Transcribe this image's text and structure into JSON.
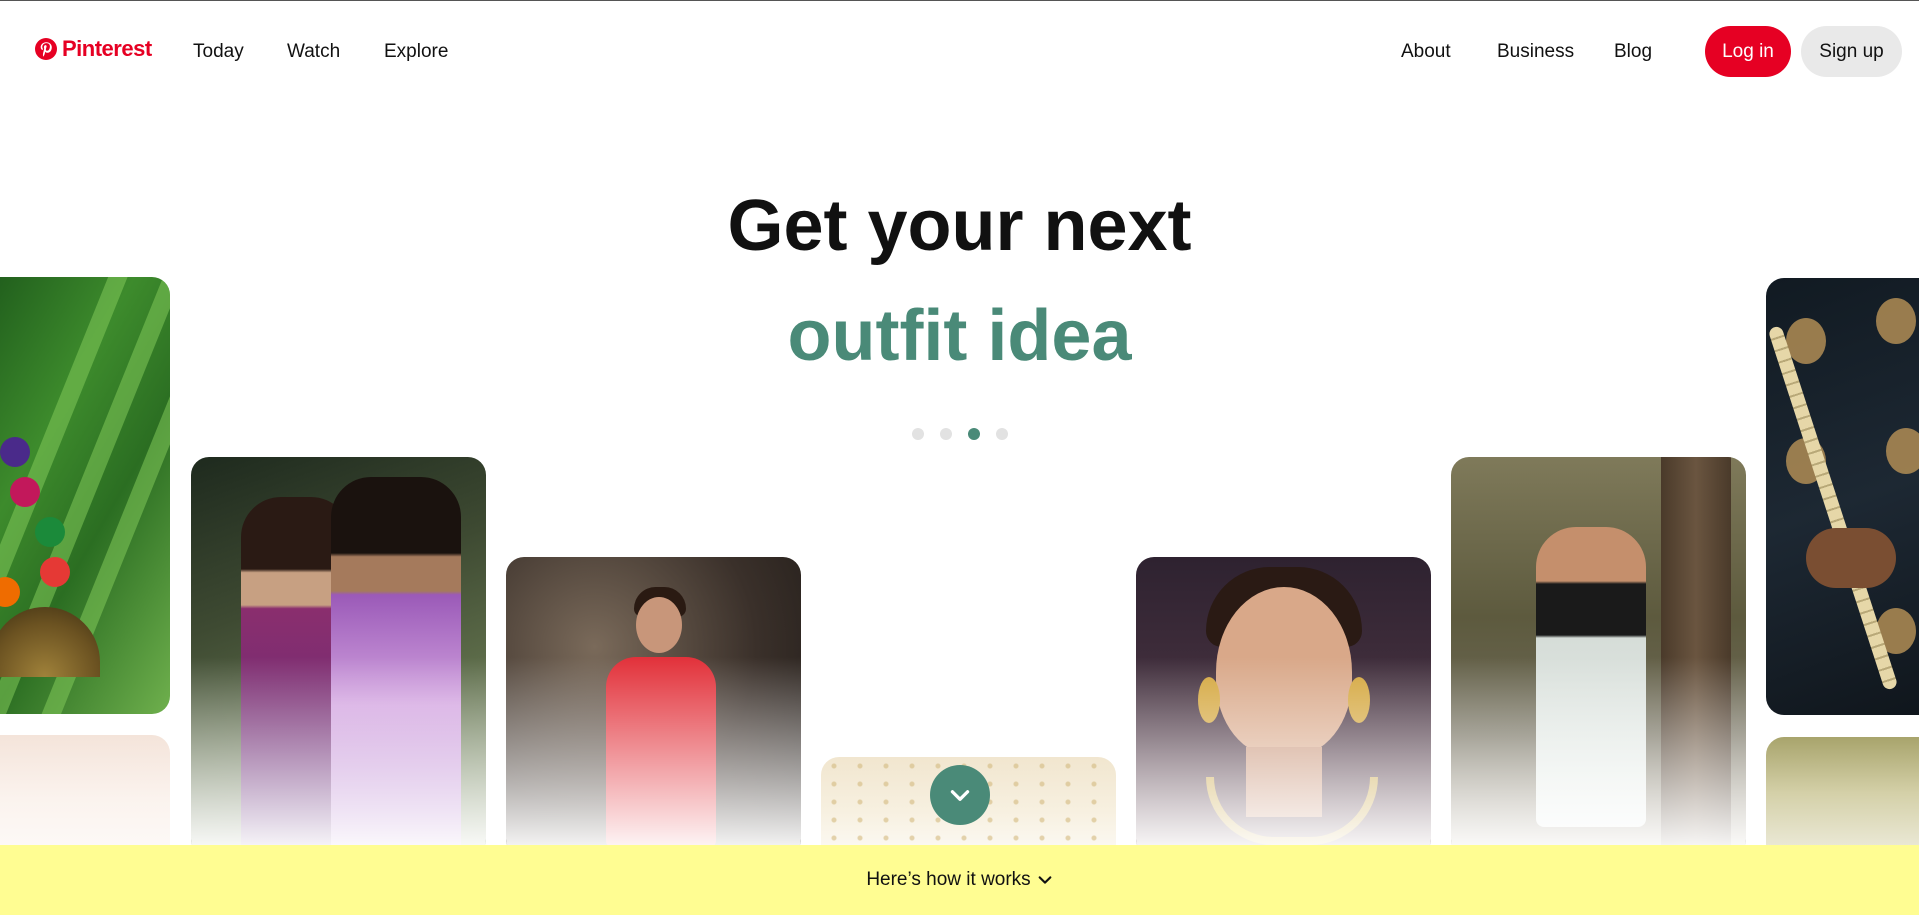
{
  "brand": {
    "name": "Pinterest",
    "color": "#e60023",
    "icon": "pinterest-logo-icon"
  },
  "nav_left": [
    {
      "label": "Today"
    },
    {
      "label": "Watch"
    },
    {
      "label": "Explore"
    }
  ],
  "nav_right": [
    {
      "label": "About"
    },
    {
      "label": "Business"
    },
    {
      "label": "Blog"
    }
  ],
  "auth": {
    "login_label": "Log in",
    "signup_label": "Sign up",
    "login_color": "#e60023",
    "signup_color": "#e9e9e9"
  },
  "hero": {
    "line1": "Get your next",
    "line2": "outfit idea",
    "accent_color": "#4a8a78",
    "carousel_total": 4,
    "carousel_active": 3
  },
  "scroll_button": {
    "icon": "chevron-down-icon"
  },
  "how_it_works": {
    "label": "Here’s how it works",
    "icon": "chevron-down-icon",
    "background": "#fffd92"
  }
}
